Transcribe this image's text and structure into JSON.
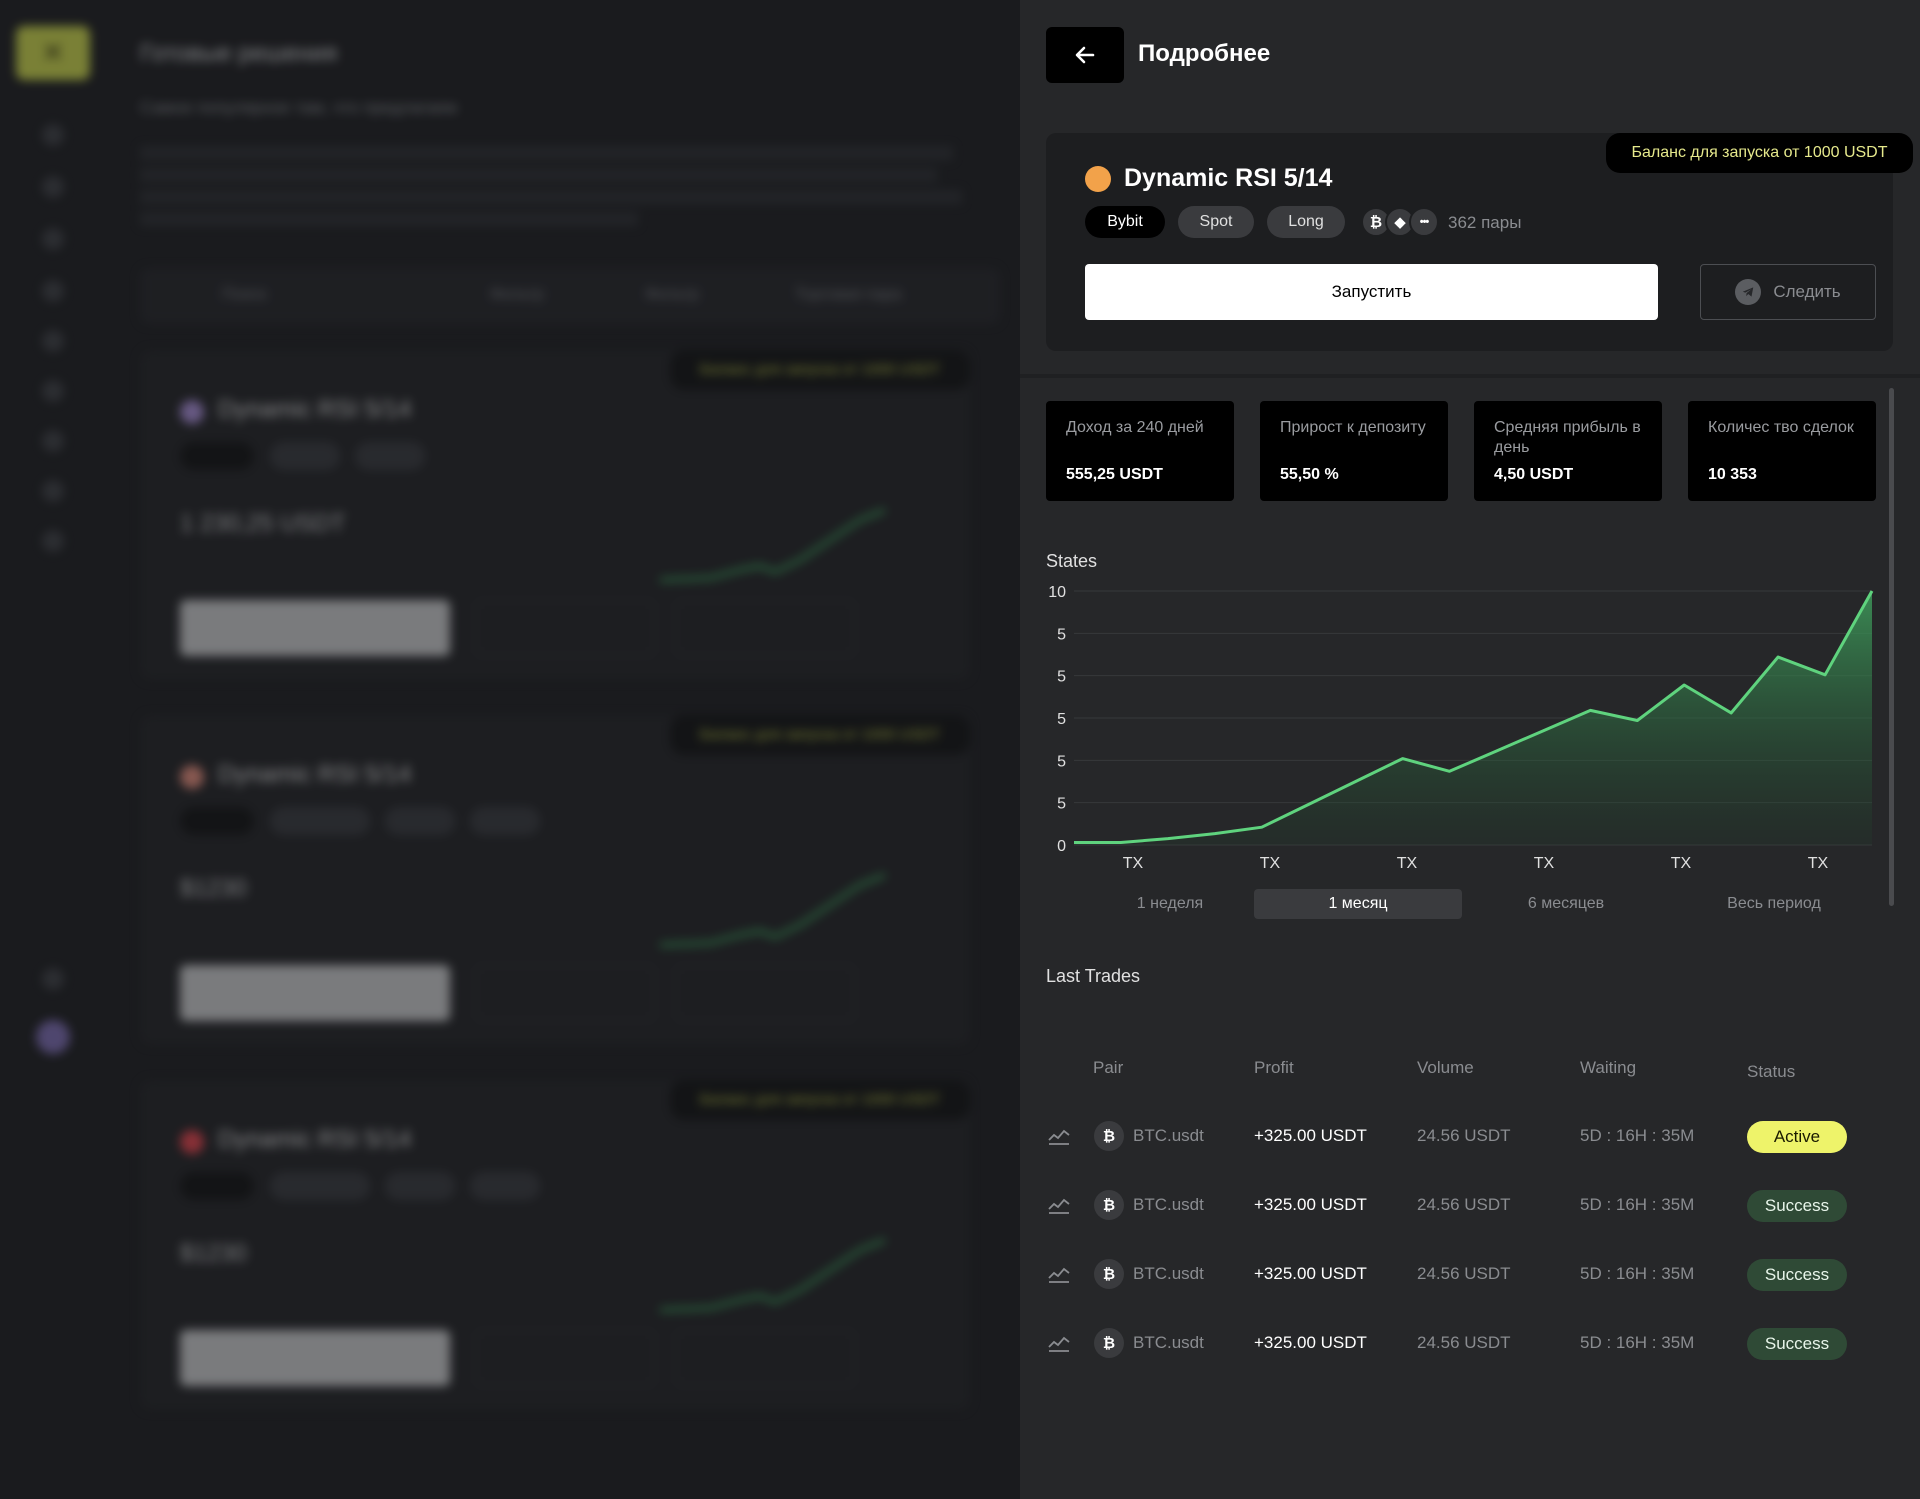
{
  "background": {
    "title": "Готовые решения",
    "subtitle": "Самое популярное там, что предлагаем",
    "filter_items": [
      "Поиск",
      "Фильтр",
      "Фильтр",
      "Торговая пара"
    ],
    "cards": [
      {
        "name": "Dynamic RSI 5/14",
        "badge": "Баланс для запуска от 1000 USDT",
        "amount": "1 230,25 USDT",
        "dot_color": "#a58bd4"
      },
      {
        "name": "Dynamic RSI 5/14",
        "badge": "Баланс для запуска от 1000 USDT",
        "amount": "$1230",
        "dot_color": "#e08a7a"
      },
      {
        "name": "Dynamic RSI 5/14",
        "badge": "Баланс для запуска от 1000 USDT",
        "amount": "$1230",
        "dot_color": "#e0414a"
      }
    ]
  },
  "header": {
    "title": "Подробнее",
    "back_icon": "arrow-left-icon"
  },
  "strategy": {
    "badge": "Баланс для запуска от 1000 USDT",
    "name": "Dynamic RSI 5/14",
    "dot_color": "#f2a24a",
    "tags": [
      "Bybit",
      "Spot",
      "Long"
    ],
    "coins": [
      "₿",
      "◆",
      "•••"
    ],
    "pairs": "362 пары",
    "start_button": "Запустить",
    "follow_button": "Следить"
  },
  "stats": [
    {
      "label": "Доход за 240 дней",
      "value": "555,25 USDT"
    },
    {
      "label": "Прирост к депозиту",
      "value": "55,50 %"
    },
    {
      "label": "Средняя прибыль в день",
      "value": "4,50 USDT"
    },
    {
      "label": "Количес тво сделок",
      "value": "10 353"
    }
  ],
  "chart_data": {
    "type": "area",
    "title": "States",
    "y_tick_labels": [
      "10",
      "5",
      "5",
      "5",
      "5",
      "5",
      "0"
    ],
    "x_tick_labels": [
      "TX",
      "TX",
      "TX",
      "TX",
      "TX",
      "TX"
    ],
    "values": [
      0.1,
      0.1,
      0.25,
      0.45,
      0.7,
      1.6,
      2.5,
      3.4,
      2.9,
      3.7,
      4.5,
      5.3,
      4.9,
      6.3,
      5.2,
      7.4,
      6.7,
      10
    ],
    "ylim": [
      0,
      10
    ],
    "color": "#5fd37e",
    "grid": true
  },
  "periods": [
    "1 неделя",
    "1 месяц",
    "6 месяцев",
    "Весь период"
  ],
  "trades": {
    "title": "Last Trades",
    "headers": [
      "Pair",
      "Profit",
      "Volume",
      "Waiting",
      "Status"
    ],
    "rows": [
      {
        "pair": "BTC.usdt",
        "profit": "+325.00 USDT",
        "volume": "24.56 USDT",
        "waiting": "5D : 16H : 35M",
        "status": "Active"
      },
      {
        "pair": "BTC.usdt",
        "profit": "+325.00 USDT",
        "volume": "24.56 USDT",
        "waiting": "5D : 16H : 35M",
        "status": "Success"
      },
      {
        "pair": "BTC.usdt",
        "profit": "+325.00 USDT",
        "volume": "24.56 USDT",
        "waiting": "5D : 16H : 35M",
        "status": "Success"
      },
      {
        "pair": "BTC.usdt",
        "profit": "+325.00 USDT",
        "volume": "24.56 USDT",
        "waiting": "5D : 16H : 35M",
        "status": "Success"
      }
    ]
  },
  "colors": {
    "accent": "#eef36a",
    "success": "#2f4a36",
    "chart_line": "#5fd37e",
    "panel": "#262729"
  }
}
